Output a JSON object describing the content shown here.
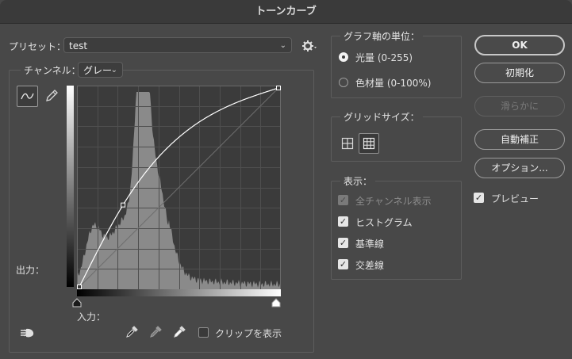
{
  "dialog": {
    "title": "トーンカーブ"
  },
  "preset": {
    "label": "プリセット：",
    "value": "test"
  },
  "channel": {
    "label": "チャンネル：",
    "value": "グレー"
  },
  "axes": {
    "output_label": "出力：",
    "input_label": "入力："
  },
  "clip": {
    "label": "クリップを表示",
    "checked": false
  },
  "graph_unit": {
    "title": "グラフ軸の単位：",
    "options": [
      {
        "label": "光量 (0-255)",
        "selected": true
      },
      {
        "label": "色材量 (0-100%)",
        "selected": false
      }
    ]
  },
  "grid_size": {
    "title": "グリッドサイズ：",
    "selected": "fine"
  },
  "display": {
    "title": "表示：",
    "options": [
      {
        "label": "全チャンネル表示",
        "checked": true,
        "enabled": false
      },
      {
        "label": "ヒストグラム",
        "checked": true,
        "enabled": true
      },
      {
        "label": "基準線",
        "checked": true,
        "enabled": true
      },
      {
        "label": "交差線",
        "checked": true,
        "enabled": true
      }
    ]
  },
  "buttons": {
    "ok": "OK",
    "reset": "初期化",
    "smooth": "滑らかに",
    "auto": "自動補正",
    "options": "オプション..."
  },
  "preview": {
    "label": "プレビュー",
    "checked": true
  },
  "curve": {
    "points": [
      [
        0,
        0
      ],
      [
        56,
        105
      ],
      [
        255,
        255
      ]
    ]
  },
  "colors": {
    "bg": "#484848",
    "graph_bg": "#3a3a3a",
    "histogram": "#8a8a8a",
    "curve": "#ffffff"
  },
  "icons": [
    "gear-icon",
    "curve-tool-icon",
    "pencil-icon",
    "target-adjust-icon",
    "black-eyedropper-icon",
    "gray-eyedropper-icon",
    "white-eyedropper-icon"
  ]
}
